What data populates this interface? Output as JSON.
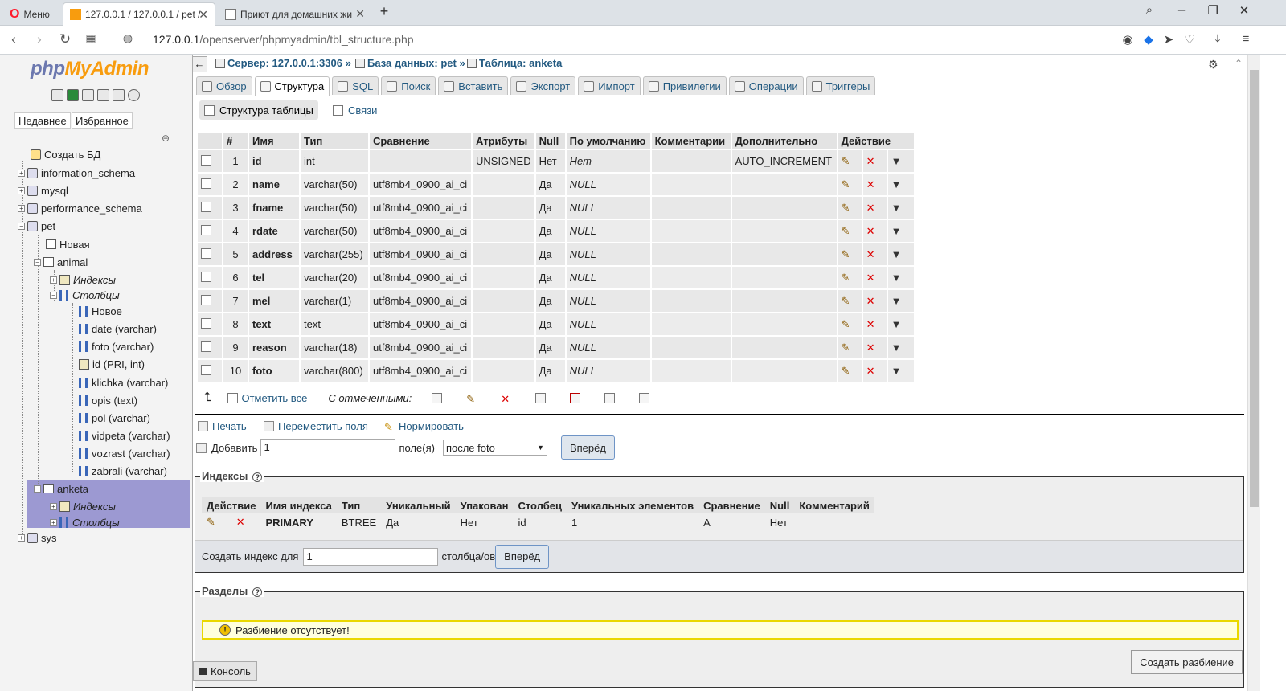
{
  "browser": {
    "menu_label": "Меню",
    "tabs": [
      {
        "title": "127.0.0.1 / 127.0.0.1 / pet /"
      },
      {
        "title": "Приют для домашних жи"
      }
    ],
    "url_host": "127.0.0.1",
    "url_path": "/openserver/phpmyadmin/tbl_structure.php"
  },
  "nav": {
    "logo_php": "php",
    "logo_myadmin": "MyAdmin",
    "recent": "Недавнее",
    "favorites": "Избранное",
    "tree": {
      "create_db": "Создать БД",
      "information_schema": "information_schema",
      "mysql": "mysql",
      "performance_schema": "performance_schema",
      "pet": "pet",
      "new_table": "Новая",
      "animal": "animal",
      "animal_indexes": "Индексы",
      "animal_columns": "Столбцы",
      "new_column": "Новое",
      "columns": [
        "date (varchar)",
        "foto (varchar)",
        "id (PRI, int)",
        "klichka (varchar)",
        "opis (text)",
        "pol (varchar)",
        "vidpeta (varchar)",
        "vozrast (varchar)",
        "zabrali (varchar)"
      ],
      "anketa": "anketa",
      "anketa_indexes": "Индексы",
      "anketa_columns": "Столбцы",
      "sys": "sys"
    }
  },
  "breadcrumb": {
    "server": "Сервер: 127.0.0.1:3306",
    "database": "База данных: pet",
    "table": "Таблица: anketa",
    "sep": "»"
  },
  "tabs": [
    "Обзор",
    "Структура",
    "SQL",
    "Поиск",
    "Вставить",
    "Экспорт",
    "Импорт",
    "Привилегии",
    "Операции",
    "Триггеры"
  ],
  "subtabs": [
    "Структура таблицы",
    "Связи"
  ],
  "structure": {
    "headers": [
      "#",
      "Имя",
      "Тип",
      "Сравнение",
      "Атрибуты",
      "Null",
      "По умолчанию",
      "Комментарии",
      "Дополнительно",
      "Действие"
    ],
    "rows": [
      {
        "num": "1",
        "name": "id",
        "type": "int",
        "collation": "",
        "attr": "UNSIGNED",
        "null": "Нет",
        "default": "Нет",
        "comment": "",
        "extra": "AUTO_INCREMENT"
      },
      {
        "num": "2",
        "name": "name",
        "type": "varchar(50)",
        "collation": "utf8mb4_0900_ai_ci",
        "attr": "",
        "null": "Да",
        "default": "NULL",
        "comment": "",
        "extra": ""
      },
      {
        "num": "3",
        "name": "fname",
        "type": "varchar(50)",
        "collation": "utf8mb4_0900_ai_ci",
        "attr": "",
        "null": "Да",
        "default": "NULL",
        "comment": "",
        "extra": ""
      },
      {
        "num": "4",
        "name": "rdate",
        "type": "varchar(50)",
        "collation": "utf8mb4_0900_ai_ci",
        "attr": "",
        "null": "Да",
        "default": "NULL",
        "comment": "",
        "extra": ""
      },
      {
        "num": "5",
        "name": "address",
        "type": "varchar(255)",
        "collation": "utf8mb4_0900_ai_ci",
        "attr": "",
        "null": "Да",
        "default": "NULL",
        "comment": "",
        "extra": ""
      },
      {
        "num": "6",
        "name": "tel",
        "type": "varchar(20)",
        "collation": "utf8mb4_0900_ai_ci",
        "attr": "",
        "null": "Да",
        "default": "NULL",
        "comment": "",
        "extra": ""
      },
      {
        "num": "7",
        "name": "mel",
        "type": "varchar(1)",
        "collation": "utf8mb4_0900_ai_ci",
        "attr": "",
        "null": "Да",
        "default": "NULL",
        "comment": "",
        "extra": ""
      },
      {
        "num": "8",
        "name": "text",
        "type": "text",
        "collation": "utf8mb4_0900_ai_ci",
        "attr": "",
        "null": "Да",
        "default": "NULL",
        "comment": "",
        "extra": ""
      },
      {
        "num": "9",
        "name": "reason",
        "type": "varchar(18)",
        "collation": "utf8mb4_0900_ai_ci",
        "attr": "",
        "null": "Да",
        "default": "NULL",
        "comment": "",
        "extra": ""
      },
      {
        "num": "10",
        "name": "foto",
        "type": "varchar(800)",
        "collation": "utf8mb4_0900_ai_ci",
        "attr": "",
        "null": "Да",
        "default": "NULL",
        "comment": "",
        "extra": ""
      }
    ],
    "check_all": "Отметить все",
    "with_selected": "С отмеченными:"
  },
  "tools": {
    "print": "Печать",
    "move": "Переместить поля",
    "normalize": "Нормировать",
    "add": "Добавить",
    "add_value": "1",
    "fields": "поле(я)",
    "after": "после foto",
    "go": "Вперёд"
  },
  "indexes": {
    "legend": "Индексы",
    "headers": [
      "Действие",
      "Имя индекса",
      "Тип",
      "Уникальный",
      "Упакован",
      "Столбец",
      "Уникальных элементов",
      "Сравнение",
      "Null",
      "Комментарий"
    ],
    "row": {
      "name": "PRIMARY",
      "type": "BTREE",
      "unique": "Да",
      "packed": "Нет",
      "column": "id",
      "cardinality": "1",
      "collation": "A",
      "null": "Нет",
      "comment": ""
    },
    "create_label": "Создать индекс для",
    "create_value": "1",
    "columns_label": "столбца/ов",
    "go": "Вперёд"
  },
  "partitions": {
    "legend": "Разделы",
    "none": "Разбиение отсутствует!",
    "create": "Создать разбиение"
  },
  "console": "Консоль"
}
